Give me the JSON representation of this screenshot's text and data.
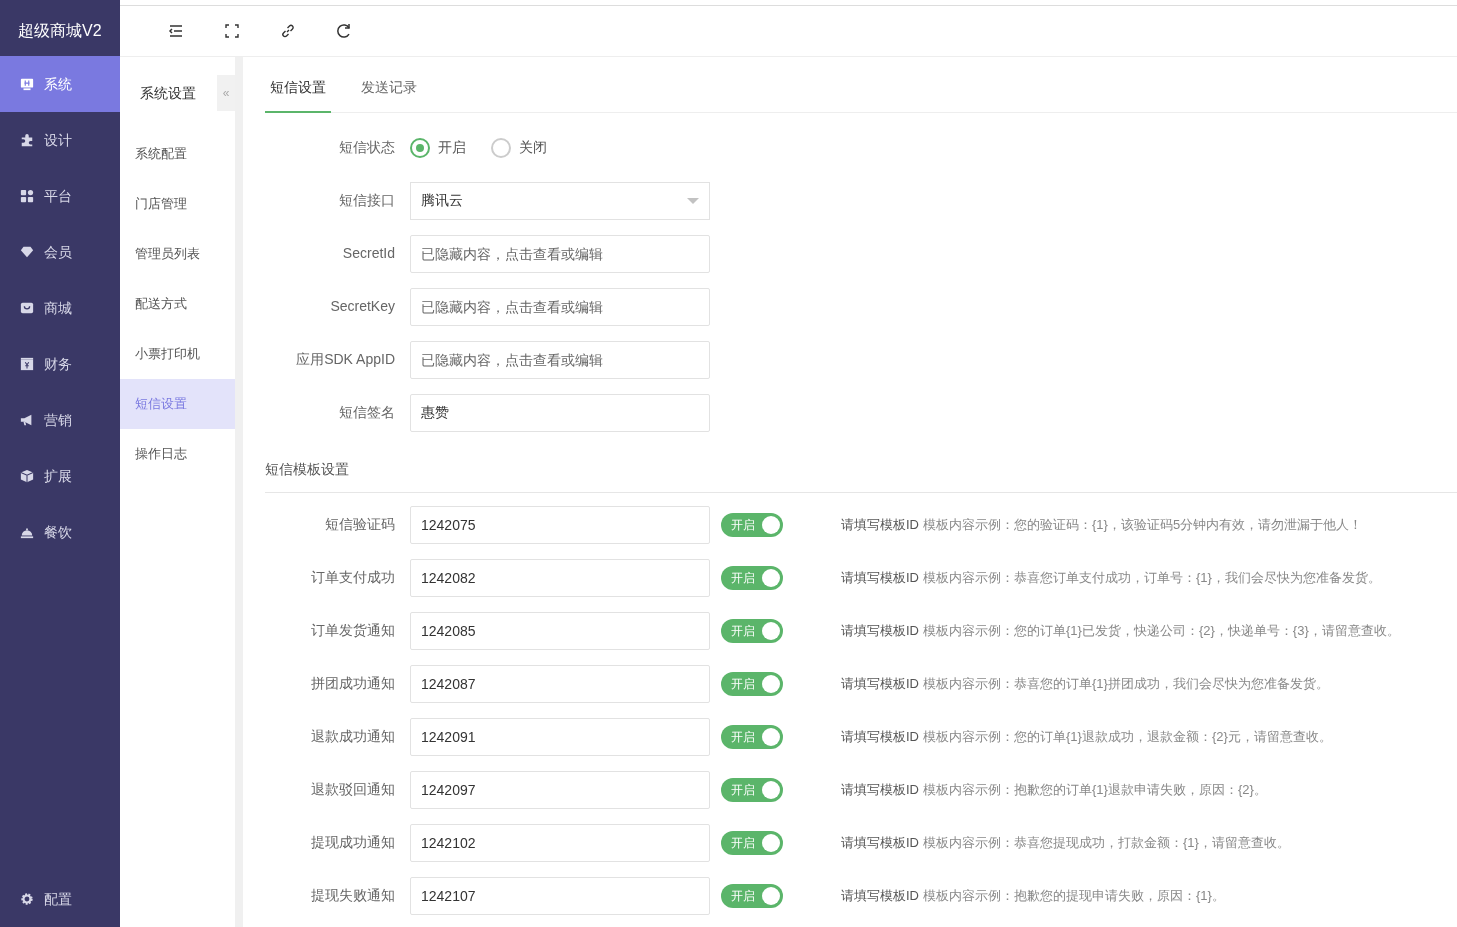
{
  "brand": "超级商城V2",
  "nav": [
    {
      "label": "系统",
      "selected": true
    },
    {
      "label": "设计",
      "selected": false
    },
    {
      "label": "平台",
      "selected": false
    },
    {
      "label": "会员",
      "selected": false
    },
    {
      "label": "商城",
      "selected": false
    },
    {
      "label": "财务",
      "selected": false
    },
    {
      "label": "营销",
      "selected": false
    },
    {
      "label": "扩展",
      "selected": false
    },
    {
      "label": "餐饮",
      "selected": false
    }
  ],
  "nav_bottom": {
    "label": "配置"
  },
  "submenu": {
    "title": "系统设置",
    "collapse": "«",
    "items": [
      {
        "label": "系统配置",
        "selected": false
      },
      {
        "label": "门店管理",
        "selected": false
      },
      {
        "label": "管理员列表",
        "selected": false
      },
      {
        "label": "配送方式",
        "selected": false
      },
      {
        "label": "小票打印机",
        "selected": false
      },
      {
        "label": "短信设置",
        "selected": true
      },
      {
        "label": "操作日志",
        "selected": false
      }
    ]
  },
  "tabs": [
    {
      "label": "短信设置",
      "selected": true
    },
    {
      "label": "发送记录",
      "selected": false
    }
  ],
  "form": [
    {
      "kind": "radio",
      "label": "短信状态",
      "options": [
        {
          "label": "开启",
          "selected": true
        },
        {
          "label": "关闭",
          "selected": false
        }
      ]
    },
    {
      "kind": "select",
      "label": "短信接口",
      "value": "腾讯云"
    },
    {
      "kind": "input",
      "label": "SecretId",
      "placeholder": "已隐藏内容，点击查看或编辑"
    },
    {
      "kind": "input",
      "label": "SecretKey",
      "placeholder": "已隐藏内容，点击查看或编辑"
    },
    {
      "kind": "input",
      "label": "应用SDK AppID",
      "placeholder": "已隐藏内容，点击查看或编辑"
    },
    {
      "kind": "input",
      "label": "短信签名",
      "value": "惠赞"
    }
  ],
  "template_section": "短信模板设置",
  "templates": [
    {
      "label": "短信验证码",
      "value": "1242075",
      "switch_label": "开启",
      "on": true,
      "hint": "请填写模板ID",
      "example": "模板内容示例：您的验证码：{1}，该验证码5分钟内有效，请勿泄漏于他人！"
    },
    {
      "label": "订单支付成功",
      "value": "1242082",
      "switch_label": "开启",
      "on": true,
      "hint": "请填写模板ID",
      "example": "模板内容示例：恭喜您订单支付成功，订单号：{1}，我们会尽快为您准备发货。"
    },
    {
      "label": "订单发货通知",
      "value": "1242085",
      "switch_label": "开启",
      "on": true,
      "hint": "请填写模板ID",
      "example": "模板内容示例：您的订单{1}已发货，快递公司：{2}，快递单号：{3}，请留意查收。"
    },
    {
      "label": "拼团成功通知",
      "value": "1242087",
      "switch_label": "开启",
      "on": true,
      "hint": "请填写模板ID",
      "example": "模板内容示例：恭喜您的订单{1}拼团成功，我们会尽快为您准备发货。"
    },
    {
      "label": "退款成功通知",
      "value": "1242091",
      "switch_label": "开启",
      "on": true,
      "hint": "请填写模板ID",
      "example": "模板内容示例：您的订单{1}退款成功，退款金额：{2}元，请留意查收。"
    },
    {
      "label": "退款驳回通知",
      "value": "1242097",
      "switch_label": "开启",
      "on": true,
      "hint": "请填写模板ID",
      "example": "模板内容示例：抱歉您的订单{1}退款申请失败，原因：{2}。"
    },
    {
      "label": "提现成功通知",
      "value": "1242102",
      "switch_label": "开启",
      "on": true,
      "hint": "请填写模板ID",
      "example": "模板内容示例：恭喜您提现成功，打款金额：{1}，请留意查收。"
    },
    {
      "label": "提现失败通知",
      "value": "1242107",
      "switch_label": "开启",
      "on": true,
      "hint": "请填写模板ID",
      "example": "模板内容示例：抱歉您的提现申请失败，原因：{1}。"
    }
  ]
}
